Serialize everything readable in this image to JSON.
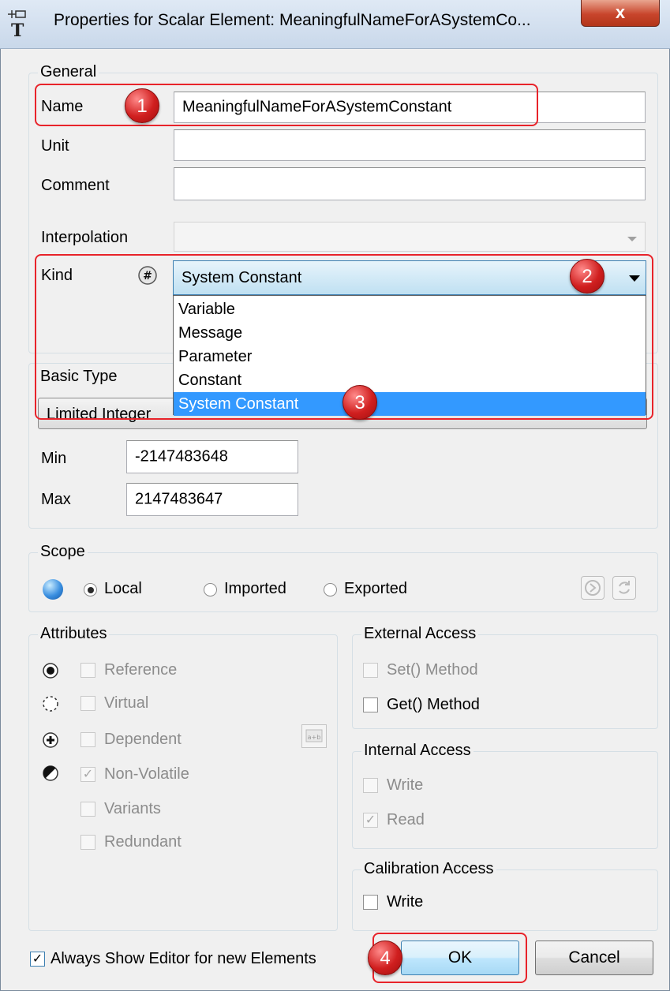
{
  "window": {
    "title": "Properties for Scalar Element: MeaningfulNameForASystemCo...",
    "close_label": "x"
  },
  "general": {
    "legend": "General",
    "name_label": "Name",
    "name_value": "MeaningfulNameForASystemConstant",
    "unit_label": "Unit",
    "unit_value": "",
    "comment_label": "Comment",
    "comment_value": "",
    "interpolation_label": "Interpolation",
    "interpolation_value": "",
    "kind_label": "Kind",
    "kind_value": "System Constant",
    "kind_options": [
      "Variable",
      "Message",
      "Parameter",
      "Constant",
      "System Constant"
    ]
  },
  "basic_type": {
    "legend": "Basic Type",
    "value": "Limited Integer",
    "min_label": "Min",
    "min_value": "-2147483648",
    "max_label": "Max",
    "max_value": "2147483647"
  },
  "scope": {
    "legend": "Scope",
    "local_label": "Local",
    "imported_label": "Imported",
    "exported_label": "Exported",
    "selected": "Local"
  },
  "attributes": {
    "legend": "Attributes",
    "reference": "Reference",
    "virtual": "Virtual",
    "dependent": "Dependent",
    "non_volatile": "Non-Volatile",
    "variants": "Variants",
    "redundant": "Redundant"
  },
  "external_access": {
    "legend": "External Access",
    "set_method": "Set() Method",
    "get_method": "Get() Method"
  },
  "internal_access": {
    "legend": "Internal Access",
    "write": "Write",
    "read": "Read"
  },
  "calibration_access": {
    "legend": "Calibration Access",
    "write": "Write"
  },
  "footer": {
    "always_show_label": "Always Show Editor for new Elements",
    "ok_label": "OK",
    "cancel_label": "Cancel"
  },
  "annotations": [
    "1",
    "2",
    "3",
    "4"
  ],
  "colors": {
    "annotation_red": "#e8232a",
    "selection_blue": "#3399ff",
    "kind_highlight": "#bfe0f2"
  }
}
